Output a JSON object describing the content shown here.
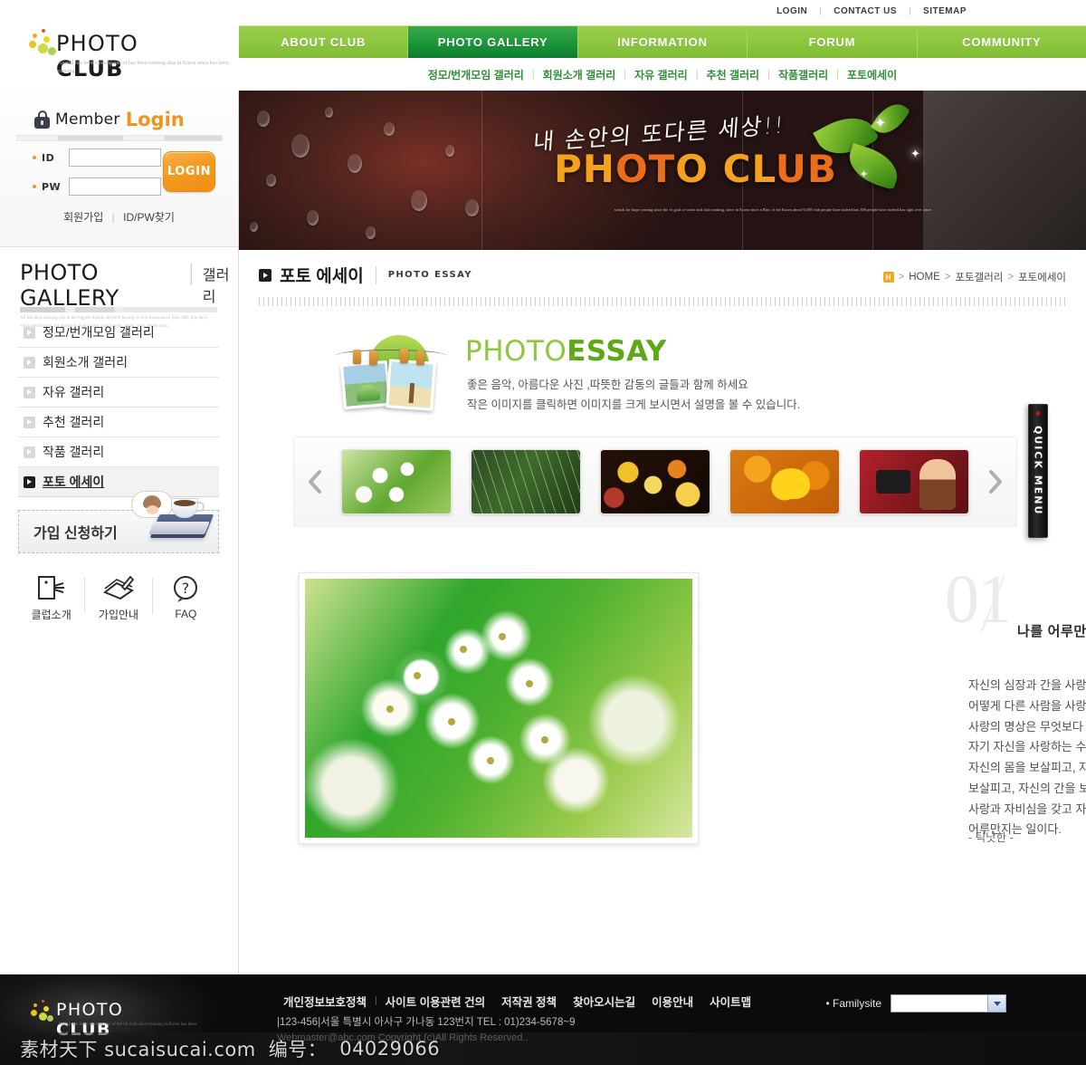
{
  "topbar": {
    "links": [
      "LOGIN",
      "CONTACT US",
      "SITEMAP"
    ]
  },
  "brand": {
    "name_light": "PHOTO ",
    "name_bold": "CLUB",
    "tagline": "Anadal has been running one of has been running\ndias in Korea since has been running"
  },
  "mainnav": {
    "items": [
      {
        "label": "ABOUT CLUB",
        "active": false
      },
      {
        "label": "PHOTO GALLERY",
        "active": true
      },
      {
        "label": "INFORMATION",
        "active": false
      },
      {
        "label": "FORUM",
        "active": false
      },
      {
        "label": "COMMUNITY",
        "active": false
      }
    ]
  },
  "subnav": {
    "items": [
      "정모/번개모임 갤러리",
      "회원소개 갤러리",
      "자유 갤러리",
      "추천 갤러리",
      "작품갤러리",
      "포토에세이"
    ]
  },
  "hero": {
    "handwriting": "내 손안의 또다른 세상!!",
    "title_1": "PH",
    "title_2": "OT",
    "title_3": "O CL",
    "title_4": "UB",
    "subtext": "search for hope coming since the 1s goal of water and club running, since in Korea since a Bloc of the Korea  about 9,000 club people have indeed has 300 people have indeed has right over since"
  },
  "login": {
    "title_member": "Member",
    "title_login": "Login",
    "id_label": "ID",
    "pw_label": "PW",
    "id_value": "",
    "pw_value": "",
    "button": "LOGIN",
    "link_join": "회원가입",
    "link_find": "ID/PW찾기",
    "divider": "|"
  },
  "sidebar": {
    "heading_en": "PHOTO GALLERY",
    "heading_bar": "|",
    "heading_kr": "갤러리",
    "heading_tag": "All has been running one in the biggest double and tech having. in a to Korea since Brat cl00, it to have, while and forcing, for double to eight come, club having, better, with, sembs com.",
    "items": [
      {
        "label": "정모/번개모임 갤러리",
        "active": false
      },
      {
        "label": "회원소개 갤러리",
        "active": false
      },
      {
        "label": "자유 갤러리",
        "active": false
      },
      {
        "label": "추천 갤러리",
        "active": false
      },
      {
        "label": "작품 갤러리",
        "active": false
      },
      {
        "label": "포토 에세이",
        "active": true
      }
    ],
    "join_banner": "가입 신청하기",
    "icons": [
      {
        "label": "클럽소개",
        "icon": "speech-card-icon"
      },
      {
        "label": "가입안내",
        "icon": "book-pen-icon"
      },
      {
        "label": "FAQ",
        "icon": "question-bubble-icon"
      }
    ]
  },
  "page": {
    "title_kr": "포토 에세이",
    "title_en": "PHOTO ESSAY",
    "breadcrumb": {
      "home_icon": "H",
      "items": [
        "HOME",
        "포토갤러리",
        "포토에세이"
      ],
      "separator": ">"
    }
  },
  "essay_banner": {
    "title_1": "PHOTO",
    "title_dot": ".",
    "title_2": "ESSAY",
    "line1": "좋은 음악, 아름다운 사진 ,따뜻한 감동의 글들과 함께 하세요",
    "line2": "작은 이미지를 클릭하면 이미지를 크게 보시면서 설명을 볼 수 있습니다."
  },
  "carousel": {
    "prev_icon": "chevron-left-icon",
    "next_icon": "chevron-right-icon",
    "thumbs": [
      {
        "name": "white-flowers-thumb"
      },
      {
        "name": "green-grass-dew-thumb"
      },
      {
        "name": "bokeh-lights-thumb"
      },
      {
        "name": "ginkgo-leaf-thumb"
      },
      {
        "name": "photographer-woman-thumb"
      }
    ]
  },
  "essay": {
    "number": "01",
    "title": "나를 어루만지는 일",
    "body": "자신의 심장과 간을 사랑하지 못하면서,\n어떻게 다른 사람을 사랑할 수 있겠는가?\n사랑의 명상은 무엇보다\n자기 자신을 사랑하는 수행이다.\n자신의 몸을 보살피고, 자신의 심장을\n보살피고, 자신의 간을 보살피는 수행이다.\n사랑과 자비심을 갖고 자기 자신을\n어루만지는 일이다.",
    "signature": "- 틱낫한 -",
    "photo_name": "white-flowers-main-photo"
  },
  "quickmenu": {
    "label": "QUICK MENU"
  },
  "footer": {
    "logo_light": "PHOTO ",
    "logo_bold": "CLUB",
    "logo_tag": "Anadal has been running one of the hit\nclub since running in Korea has been",
    "links": [
      "개인정보보호정책",
      "사이트 이용관련 건의",
      "저작권 정책",
      "찾아오시는길",
      "이용안내",
      "사이트맵"
    ],
    "divider": "|",
    "address": "|123-456|서울 특별시 아사구 가나동 123번지 TEL : 01)234-5678~9",
    "copyright": "Webmaster@abc.com Copyright (c)All Rights Reserved..",
    "familysite_label": "• Familysite",
    "familysite_value": ""
  },
  "watermark": {
    "site": "素材天下 sucaisucai.com",
    "id_label": "编号：",
    "id_value": "04029066"
  },
  "colors": {
    "nav_green": "#8cc63f",
    "nav_active_green": "#199339",
    "accent_orange": "#f0941f",
    "essay_green": "#8dc63f",
    "breadcrumb_orange": "#f0a81f"
  }
}
